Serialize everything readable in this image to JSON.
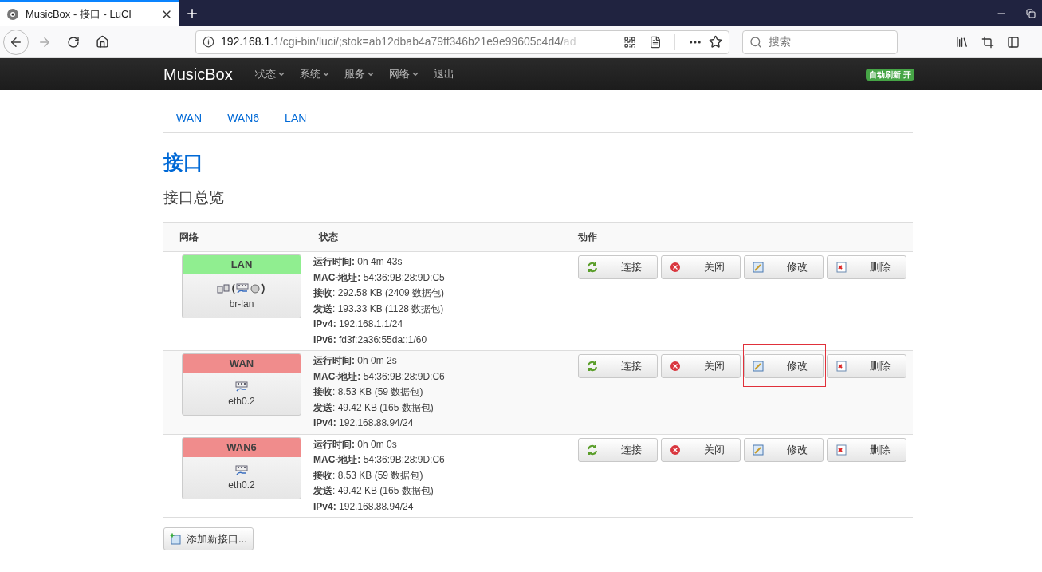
{
  "browser": {
    "tab_title": "MusicBox - 接口 - LuCI",
    "url_host": "192.168.1.1",
    "url_path": "/cgi-bin/luci/;stok=ab12dbab4a79ff346b21e9e99605c4d4/",
    "url_faded": "ad",
    "search_placeholder": "搜索"
  },
  "navbar": {
    "brand": "MusicBox",
    "menus": [
      {
        "label": "状态",
        "dropdown": true
      },
      {
        "label": "系统",
        "dropdown": true
      },
      {
        "label": "服务",
        "dropdown": true
      },
      {
        "label": "网络",
        "dropdown": true
      },
      {
        "label": "退出",
        "dropdown": false
      }
    ],
    "badge": "自动刷新 开"
  },
  "subtabs": [
    {
      "label": "WAN"
    },
    {
      "label": "WAN6"
    },
    {
      "label": "LAN"
    }
  ],
  "title": "接口",
  "subtitle": "接口总览",
  "table": {
    "columns": [
      "网络",
      "状态",
      "动作"
    ],
    "rows": [
      {
        "name": "LAN",
        "color": "#90ee90",
        "bridge": true,
        "device": "br-lan",
        "status": [
          {
            "label": "运行时间:",
            "value": "0h 4m 43s"
          },
          {
            "label": "MAC-地址:",
            "value": "54:36:9B:28:9D:C5"
          },
          {
            "label": "接收",
            "value": ": 292.58 KB (2409 数据包)"
          },
          {
            "label": "发送",
            "value": ": 193.33 KB (1128 数据包)"
          },
          {
            "label": "IPv4:",
            "value": "192.168.1.1/24"
          },
          {
            "label": "IPv6:",
            "value": "fd3f:2a36:55da::1/60"
          }
        ],
        "actions": [
          {
            "kind": "connect",
            "label": "连接",
            "highlighted": false
          },
          {
            "kind": "stop",
            "label": "关闭",
            "highlighted": false
          },
          {
            "kind": "edit",
            "label": "修改",
            "highlighted": false
          },
          {
            "kind": "delete",
            "label": "删除",
            "highlighted": false
          }
        ]
      },
      {
        "name": "WAN",
        "color": "#f08c8c",
        "bridge": false,
        "device": "eth0.2",
        "status": [
          {
            "label": "运行时间:",
            "value": "0h 0m 2s"
          },
          {
            "label": "MAC-地址:",
            "value": "54:36:9B:28:9D:C6"
          },
          {
            "label": "接收",
            "value": ": 8.53 KB (59 数据包)"
          },
          {
            "label": "发送",
            "value": ": 49.42 KB (165 数据包)"
          },
          {
            "label": "IPv4:",
            "value": "192.168.88.94/24"
          }
        ],
        "actions": [
          {
            "kind": "connect",
            "label": "连接",
            "highlighted": false
          },
          {
            "kind": "stop",
            "label": "关闭",
            "highlighted": false
          },
          {
            "kind": "edit",
            "label": "修改",
            "highlighted": true
          },
          {
            "kind": "delete",
            "label": "删除",
            "highlighted": false
          }
        ]
      },
      {
        "name": "WAN6",
        "color": "#f08c8c",
        "bridge": false,
        "device": "eth0.2",
        "status": [
          {
            "label": "运行时间:",
            "value": "0h 0m 0s"
          },
          {
            "label": "MAC-地址:",
            "value": "54:36:9B:28:9D:C6"
          },
          {
            "label": "接收",
            "value": ": 8.53 KB (59 数据包)"
          },
          {
            "label": "发送",
            "value": ": 49.42 KB (165 数据包)"
          },
          {
            "label": "IPv4:",
            "value": "192.168.88.94/24"
          }
        ],
        "actions": [
          {
            "kind": "connect",
            "label": "连接",
            "highlighted": false
          },
          {
            "kind": "stop",
            "label": "关闭",
            "highlighted": false
          },
          {
            "kind": "edit",
            "label": "修改",
            "highlighted": false
          },
          {
            "kind": "delete",
            "label": "删除",
            "highlighted": false
          }
        ]
      }
    ]
  },
  "add_button": "添加新接口..."
}
